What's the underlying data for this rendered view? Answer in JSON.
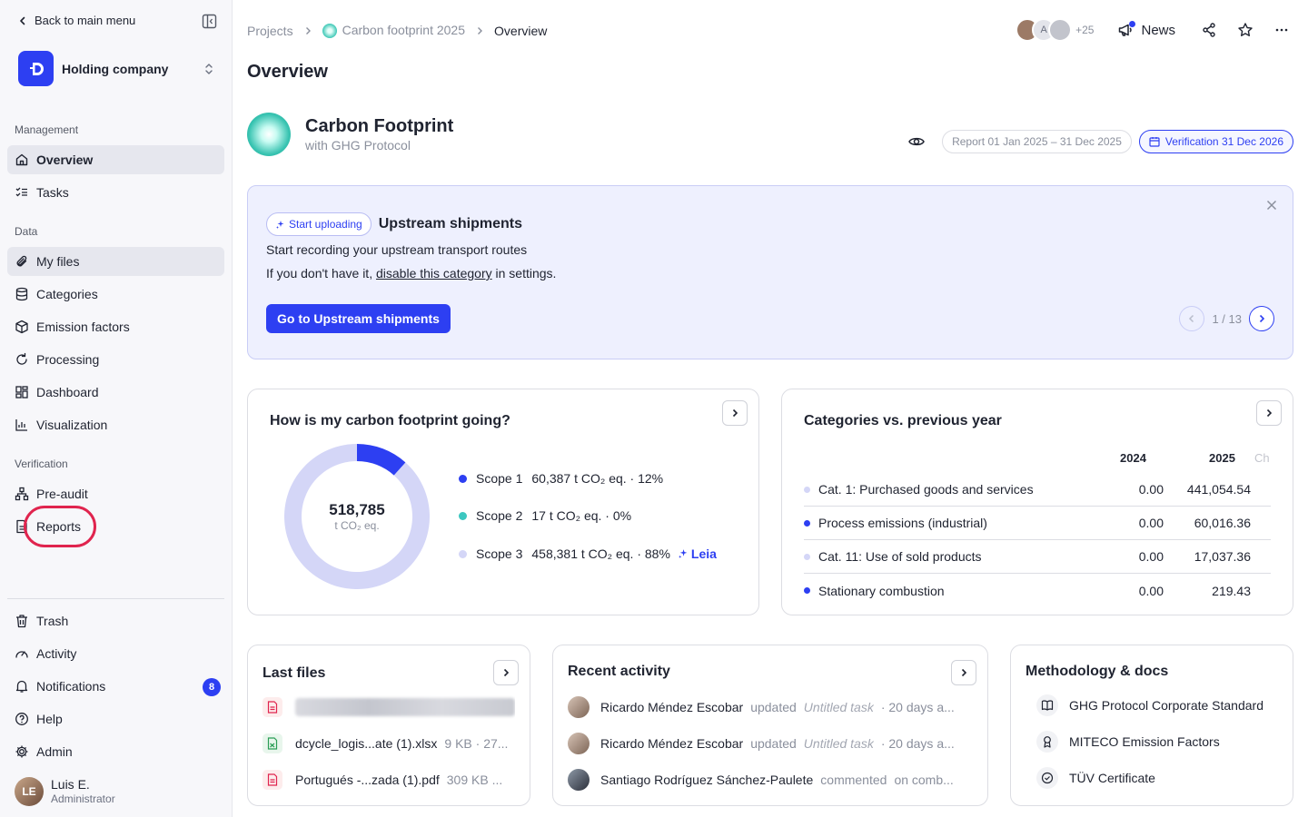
{
  "sidebar": {
    "back_label": "Back to main menu",
    "org_name": "Holding company",
    "sections": {
      "management": "Management",
      "data": "Data",
      "verification": "Verification"
    },
    "items": {
      "overview": "Overview",
      "tasks": "Tasks",
      "my_files": "My files",
      "categories": "Categories",
      "emission_factors": "Emission factors",
      "processing": "Processing",
      "dashboard": "Dashboard",
      "visualization": "Visualization",
      "pre_audit": "Pre-audit",
      "reports": "Reports",
      "trash": "Trash",
      "activity": "Activity",
      "notifications": "Notifications",
      "help": "Help",
      "admin": "Admin"
    },
    "notifications_count": "8",
    "user": {
      "initials": "LE",
      "name": "Luis E.",
      "role": "Administrator"
    }
  },
  "header": {
    "breadcrumb": {
      "root": "Projects",
      "project": "Carbon footprint 2025",
      "current": "Overview"
    },
    "avatar_middle": "A",
    "avatars_more": "+25",
    "news_label": "News"
  },
  "page": {
    "title": "Overview"
  },
  "project": {
    "title": "Carbon Footprint",
    "subtitle": "with GHG Protocol",
    "report_period": "Report 01 Jan 2025 – 31 Dec 2025",
    "verification": "Verification 31 Dec 2026"
  },
  "banner": {
    "chip": "Start uploading",
    "title": "Upstream shipments",
    "line1": "Start recording your upstream transport routes",
    "line2_before": "If you don't have it,",
    "line2_link": "disable this category",
    "line2_after": "in settings.",
    "button": "Go to Upstream shipments",
    "pager": "1 / 13"
  },
  "footprint_card": {
    "title": "How is my carbon footprint going?",
    "total": "518,785",
    "unit": "t CO₂ eq.",
    "leia_label": "Leia",
    "scopes": [
      {
        "name": "Scope 1",
        "value": "60,387 t CO₂ eq. · 12%",
        "color": "#2d3ff2",
        "share": 11.64
      },
      {
        "name": "Scope 2",
        "value": "17 t CO₂ eq. · 0%",
        "color": "#3cc7c0",
        "share": 0.0033
      },
      {
        "name": "Scope 3",
        "value": "458,381 t CO₂ eq. · 88%",
        "color": "#d4d6f7",
        "share": 88.36
      }
    ]
  },
  "categories_card": {
    "title": "Categories vs. previous year",
    "col_2024": "2024",
    "col_2025": "2025",
    "col_change": "Ch",
    "rows": [
      {
        "name": "Cat. 1: Purchased goods and services",
        "v2024": "0.00",
        "v2025": "441,054.54",
        "color": "#d4d6f7"
      },
      {
        "name": "Process emissions (industrial)",
        "v2024": "0.00",
        "v2025": "60,016.36",
        "color": "#2d3ff2"
      },
      {
        "name": "Cat. 11: Use of sold products",
        "v2024": "0.00",
        "v2025": "17,037.36",
        "color": "#d4d6f7"
      },
      {
        "name": "Stationary combustion",
        "v2024": "0.00",
        "v2025": "219.43",
        "color": "#2d3ff2"
      }
    ]
  },
  "files_card": {
    "title": "Last files",
    "files": [
      {
        "name": "dcycle_logis...ate (1).xlsx",
        "meta": "9 KB · 27...",
        "type": "xlsx"
      },
      {
        "name": "Portugués -...zada (1).pdf",
        "meta": "309 KB ...",
        "type": "pdf"
      }
    ]
  },
  "activity_card": {
    "title": "Recent activity",
    "items": [
      {
        "user": "Ricardo Méndez Escobar",
        "verb": "updated",
        "object": "Untitled task",
        "meta": "· 20 days a..."
      },
      {
        "user": "Ricardo Méndez Escobar",
        "verb": "updated",
        "object": "Untitled task",
        "meta": "· 20 days a..."
      },
      {
        "user": "Santiago Rodríguez Sánchez-Paulete",
        "verb": "commented",
        "object": "on comb..."
      }
    ]
  },
  "docs_card": {
    "title": "Methodology & docs",
    "items": [
      {
        "label": "GHG Protocol Corporate Standard",
        "icon": "book-icon"
      },
      {
        "label": "MITECO Emission Factors",
        "icon": "award-icon"
      },
      {
        "label": "TÜV Certificate",
        "icon": "check-circle-icon"
      }
    ]
  }
}
